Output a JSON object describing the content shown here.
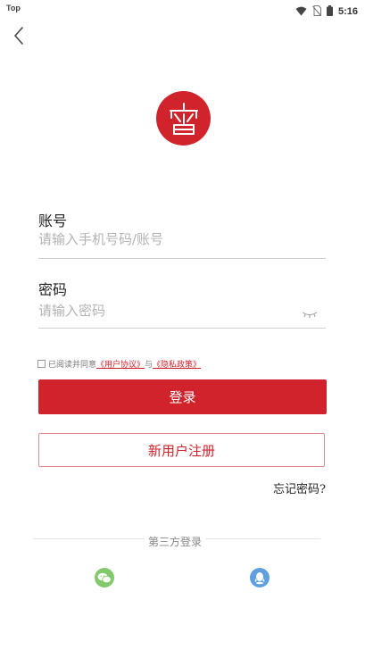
{
  "status_bar": {
    "left_label": "Top",
    "time": "5:16"
  },
  "form": {
    "account_label": "账号",
    "account_placeholder": "请输入手机号码/账号",
    "password_label": "密码",
    "password_placeholder": "请输入密码"
  },
  "agreement": {
    "prefix": "已阅读并同意",
    "user_agreement": "《用户协议》",
    "and": "与",
    "privacy_policy": "《隐私政策》"
  },
  "buttons": {
    "login": "登录",
    "register": "新用户注册",
    "forgot_password": "忘记密码?"
  },
  "third_party": {
    "label": "第三方登录"
  },
  "colors": {
    "accent": "#d0232b",
    "wechat": "#82c96b",
    "qq": "#5f9fe0"
  }
}
